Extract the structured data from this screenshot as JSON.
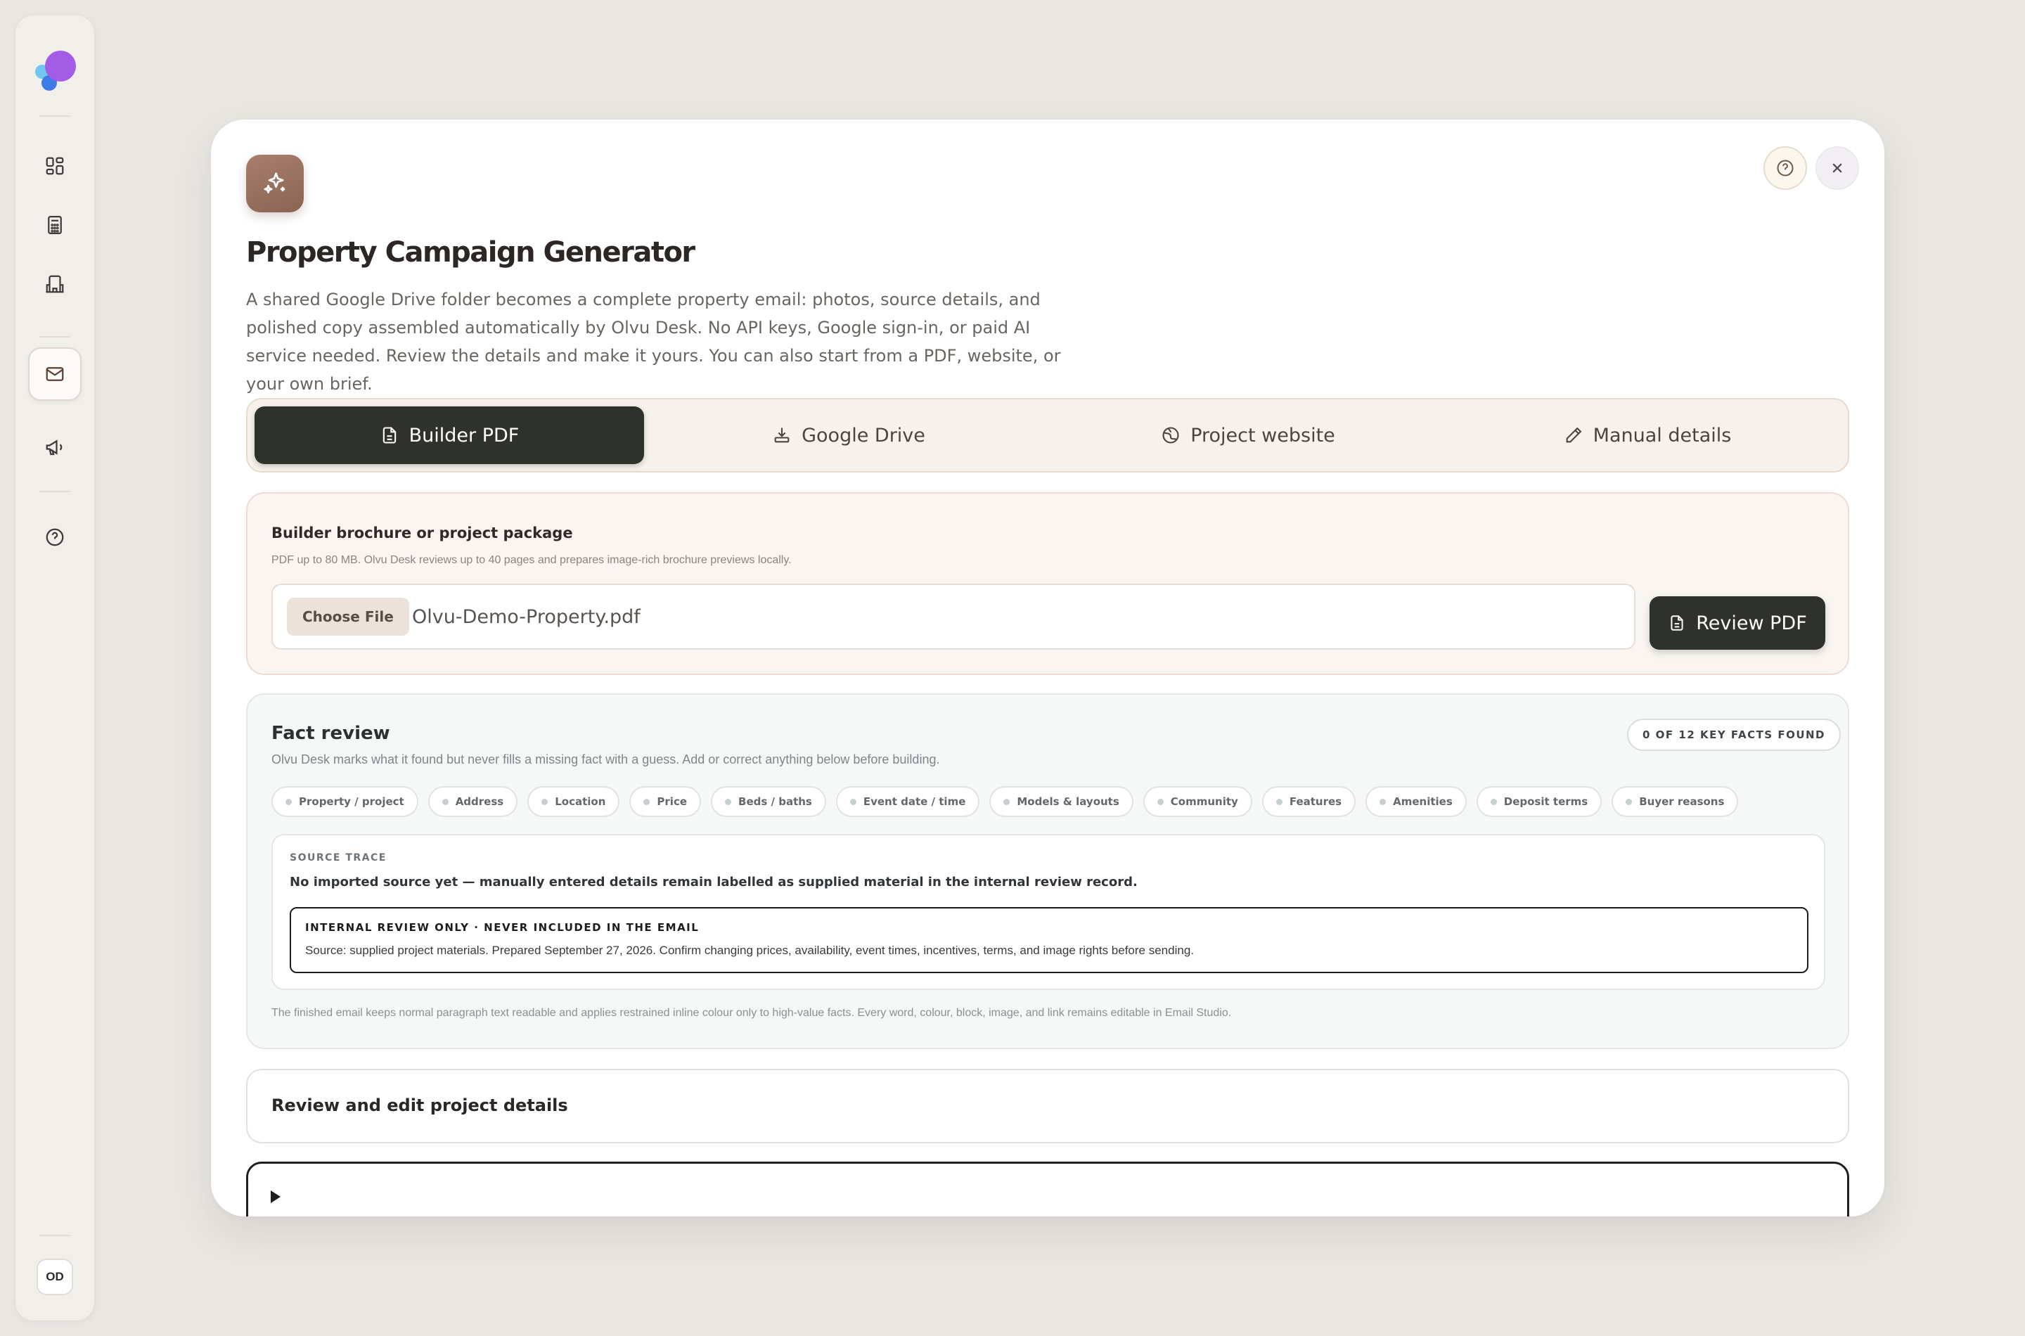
{
  "sidebar": {
    "logo": "olvu-logo",
    "items": [
      {
        "name": "dashboard",
        "icon": "grid-icon"
      },
      {
        "name": "calculator",
        "icon": "calculator-icon"
      },
      {
        "name": "buildings",
        "icon": "building-icon"
      },
      {
        "name": "email",
        "icon": "mail-icon",
        "active": true
      },
      {
        "name": "campaigns",
        "icon": "megaphone-icon"
      },
      {
        "name": "help",
        "icon": "help-circle-icon"
      }
    ],
    "avatar_initials": "OD"
  },
  "modal": {
    "title": "Property Campaign Generator",
    "intro": "A shared Google Drive folder becomes a complete property email: photos, source details, and polished copy assembled automatically by Olvu Desk. No API keys, Google sign-in, or paid AI service needed. Review the details and make it yours. You can also start from a PDF, website, or your own brief.",
    "tabs": [
      {
        "label": "Builder PDF",
        "icon": "file-icon",
        "active": true
      },
      {
        "label": "Google Drive",
        "icon": "download-tray-icon"
      },
      {
        "label": "Project website",
        "icon": "globe-icon"
      },
      {
        "label": "Manual details",
        "icon": "pencil-icon"
      }
    ]
  },
  "upload": {
    "label": "Builder brochure or project package",
    "hint": "PDF up to 80 MB. Olvu Desk reviews up to 40 pages and prepares image-rich brochure previews locally.",
    "choose_label": "Choose File",
    "file_name": "Olvu-Demo-Property.pdf",
    "review_label": "Review PDF"
  },
  "fact_review": {
    "title": "Fact review",
    "badge": "0 OF 12 KEY FACTS FOUND",
    "subtitle": "Olvu Desk marks what it found but never fills a missing fact with a guess. Add or correct anything below before building.",
    "chips": [
      "Property / project",
      "Address",
      "Location",
      "Price",
      "Beds / baths",
      "Event date / time",
      "Models & layouts",
      "Community",
      "Features",
      "Amenities",
      "Deposit terms",
      "Buyer reasons"
    ],
    "source_trace_label": "SOURCE TRACE",
    "source_trace_text": "No imported source yet — manually entered details remain labelled as supplied material in the internal review record.",
    "internal_label": "INTERNAL REVIEW ONLY · NEVER INCLUDED IN THE EMAIL",
    "internal_text": "Source: supplied project materials. Prepared September 27, 2026. Confirm changing prices, availability, event times, incentives, terms, and image rights before sending.",
    "footnote": "The finished email keeps normal paragraph text readable and applies restrained inline colour only to high-value facts. Every word, colour, block, image, and link remains editable in Email Studio."
  },
  "details": {
    "title": "Review and edit project details"
  },
  "colors": {
    "background": "#e9e7e2",
    "accent_dark": "#2f312d",
    "brand_icon": "#9a705f"
  }
}
